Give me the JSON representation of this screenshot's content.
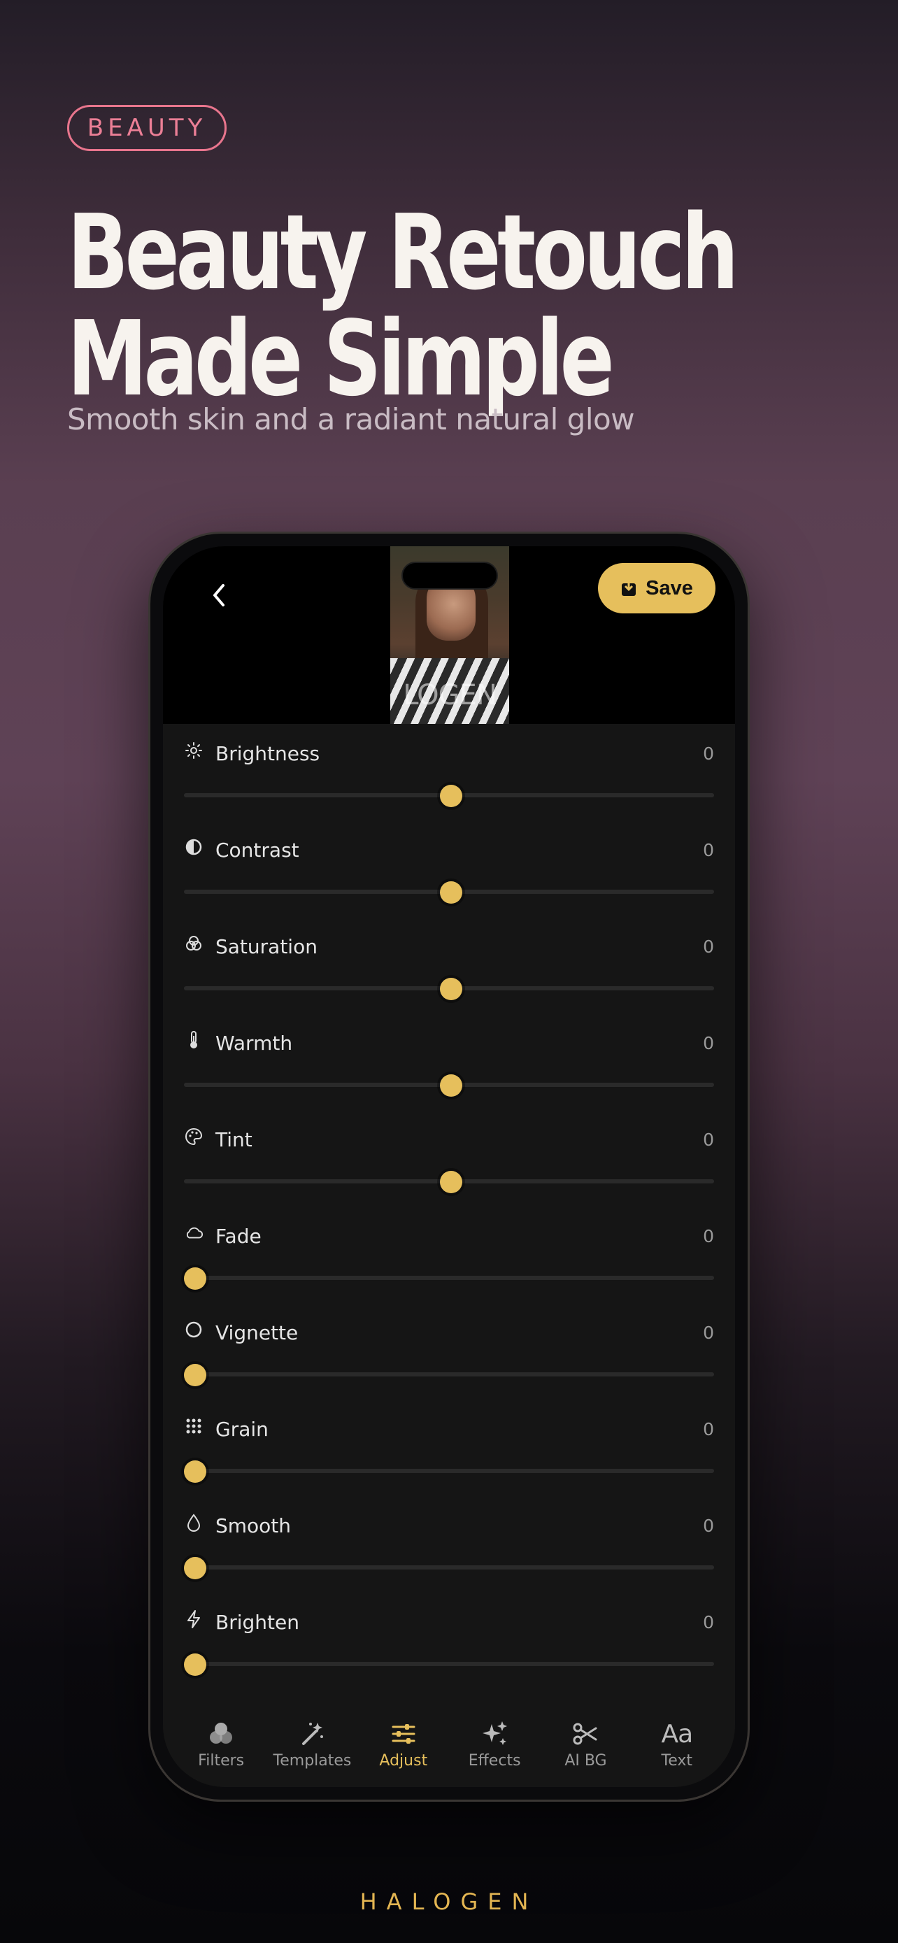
{
  "badge": "BEAUTY",
  "headline": {
    "line1": "Beauty Retouch",
    "line2": "Made Simple"
  },
  "subhead": "Smooth skin and a radiant natural glow",
  "editor": {
    "save_label": "Save",
    "preview_watermark": "LOGEN",
    "adjustments": [
      {
        "label": "Brightness",
        "value": "0",
        "icon": "sun-icon",
        "position": 0.5
      },
      {
        "label": "Contrast",
        "value": "0",
        "icon": "contrast-icon",
        "position": 0.5
      },
      {
        "label": "Saturation",
        "value": "0",
        "icon": "saturation-icon",
        "position": 0.5
      },
      {
        "label": "Warmth",
        "value": "0",
        "icon": "thermometer-icon",
        "position": 0.5
      },
      {
        "label": "Tint",
        "value": "0",
        "icon": "palette-icon",
        "position": 0.5
      },
      {
        "label": "Fade",
        "value": "0",
        "icon": "cloud-icon",
        "position": 0.0
      },
      {
        "label": "Vignette",
        "value": "0",
        "icon": "circle-icon",
        "position": 0.0
      },
      {
        "label": "Grain",
        "value": "0",
        "icon": "grid-dots-icon",
        "position": 0.0
      },
      {
        "label": "Smooth",
        "value": "0",
        "icon": "droplet-icon",
        "position": 0.0
      },
      {
        "label": "Brighten",
        "value": "0",
        "icon": "lightning-icon",
        "position": 0.0
      }
    ],
    "tabs": [
      {
        "label": "Filters",
        "icon": "filters-icon",
        "active": false
      },
      {
        "label": "Templates",
        "icon": "magic-wand-icon",
        "active": false
      },
      {
        "label": "Adjust",
        "icon": "sliders-icon",
        "active": true
      },
      {
        "label": "Effects",
        "icon": "sparkles-icon",
        "active": false
      },
      {
        "label": "AI BG",
        "icon": "scissors-icon",
        "active": false
      },
      {
        "label": "Text",
        "icon": "text-icon",
        "active": false
      }
    ]
  },
  "brand": "HALOGEN",
  "colors": {
    "accent": "#e6bf5c",
    "badge": "#ec7f96",
    "panel": "#151515"
  }
}
